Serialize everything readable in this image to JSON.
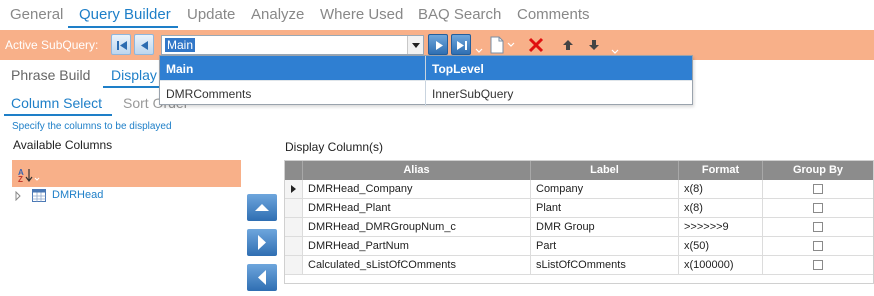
{
  "top_tabs": [
    {
      "label": "General",
      "active": false
    },
    {
      "label": "Query Builder",
      "active": true
    },
    {
      "label": "Update",
      "active": false
    },
    {
      "label": "Analyze",
      "active": false
    },
    {
      "label": "Where Used",
      "active": false
    },
    {
      "label": "BAQ Search",
      "active": false
    },
    {
      "label": "Comments",
      "active": false
    }
  ],
  "toolbar": {
    "label": "Active SubQuery:",
    "subquery_value": "Main",
    "icons": [
      "first-icon",
      "previous-icon",
      "next-icon",
      "last-icon",
      "new-icon",
      "delete-icon",
      "move-up-icon",
      "move-down-icon"
    ]
  },
  "dropdown": {
    "rows": [
      {
        "name": "Main",
        "type": "TopLevel",
        "selected": true
      },
      {
        "name": "DMRComments",
        "type": "InnerSubQuery",
        "selected": false
      }
    ]
  },
  "secondary_tabs": [
    {
      "label": "Phrase Build",
      "active": false
    },
    {
      "label": "Display",
      "active": true
    }
  ],
  "tertiary_tabs": [
    {
      "label": "Column Select",
      "active": true
    },
    {
      "label": "Sort Order",
      "active": false
    }
  ],
  "hint": "Specify the columns to be displayed",
  "available": {
    "title": "Available Columns",
    "tree": [
      {
        "label": "DMRHead",
        "icon": "table-icon"
      }
    ]
  },
  "display": {
    "title": "Display Column(s)",
    "columns": [
      "Alias",
      "Label",
      "Format",
      "Group By"
    ],
    "rows": [
      {
        "alias": "DMRHead_Company",
        "label": "Company",
        "format": "x(8)",
        "group_by": false,
        "current": true
      },
      {
        "alias": "DMRHead_Plant",
        "label": "Plant",
        "format": "x(8)",
        "group_by": false,
        "current": false
      },
      {
        "alias": "DMRHead_DMRGroupNum_c",
        "label": "DMR Group",
        "format": ">>>>>>9",
        "group_by": false,
        "current": false
      },
      {
        "alias": "DMRHead_PartNum",
        "label": "Part",
        "format": "x(50)",
        "group_by": false,
        "current": false
      },
      {
        "alias": "Calculated_sListOfCOmments",
        "label": "sListOfCOmments",
        "format": "x(100000)",
        "group_by": false,
        "current": false
      }
    ]
  },
  "colors": {
    "accent": "#1e7fc8",
    "toolbar_bg": "#f8b089",
    "header_bg": "#8c8c8c",
    "selection": "#2f7fd2"
  }
}
